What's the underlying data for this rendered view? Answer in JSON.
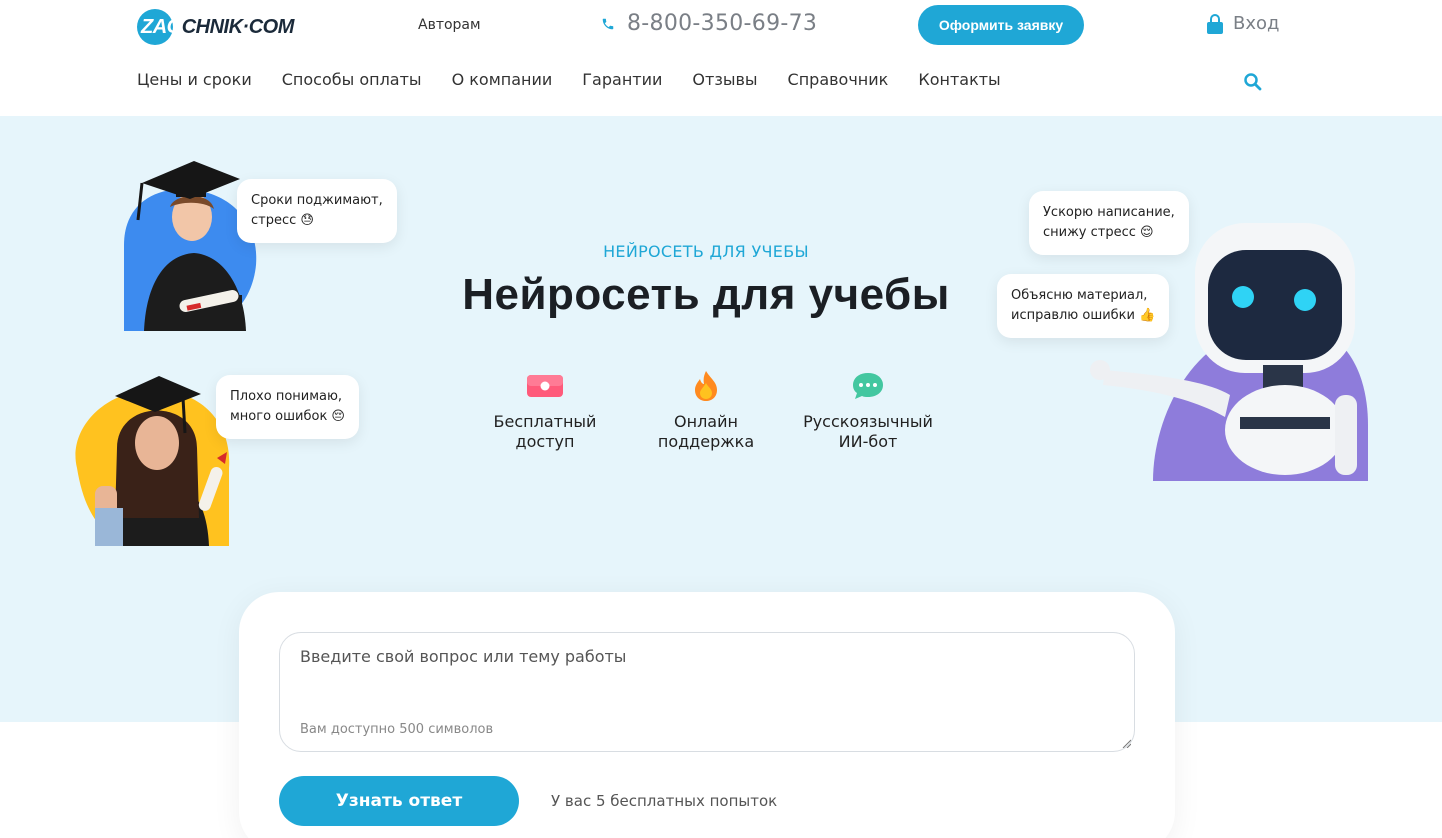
{
  "header": {
    "logo_prefix": "ZAO",
    "logo_rest": "CHNIK·COM",
    "authors_link": "Авторам",
    "phone": "8-800-350-69-73",
    "cta_button": "Оформить заявку",
    "login_label": "Вход",
    "nav": [
      "Цены и сроки",
      "Способы оплаты",
      "О компании",
      "Гарантии",
      "Отзывы",
      "Справочник",
      "Контакты"
    ]
  },
  "hero": {
    "eyebrow": "НЕЙРОСЕТЬ ДЛЯ УЧЕБЫ",
    "title": "Нейросеть для учебы",
    "features": [
      {
        "line1": "Бесплатный",
        "line2": "доступ",
        "icon": "ticket-icon"
      },
      {
        "line1": "Онлайн",
        "line2": "поддержка",
        "icon": "fire-icon"
      },
      {
        "line1": "Русскоязычный",
        "line2": "ИИ-бот",
        "icon": "chat-icon"
      }
    ],
    "bubbles": {
      "student_male_line1": "Сроки поджимают,",
      "student_male_line2": "стресс 😓",
      "student_female_line1": "Плохо понимаю,",
      "student_female_line2": "много ошибок 😔",
      "robot_top_line1": "Ускорю написание,",
      "robot_top_line2": "снижу стресс 😌",
      "robot_bottom_line1": "Объясню материал,",
      "robot_bottom_line2": "исправлю ошибки 👍"
    }
  },
  "form": {
    "placeholder": "Введите свой вопрос или тему работы",
    "char_hint": "Вам доступно 500 символов",
    "submit_label": "Узнать ответ",
    "attempts_text": "У вас 5 бесплатных попыток"
  },
  "colors": {
    "accent": "#1fa7d6",
    "hero_bg": "#e6f5fb",
    "title": "#1b1f24"
  }
}
